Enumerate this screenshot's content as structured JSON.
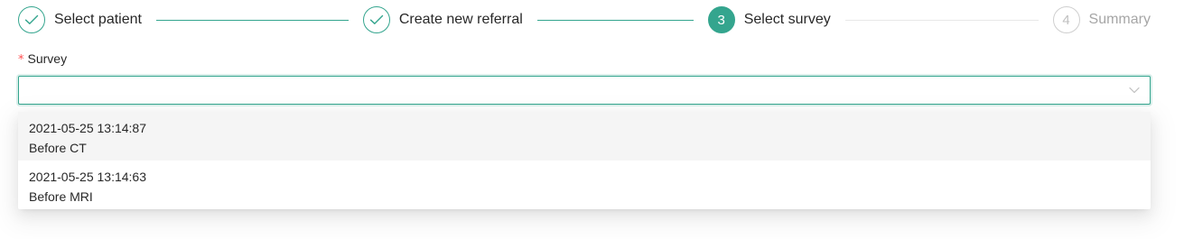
{
  "steps": [
    {
      "number": "1",
      "title": "Select patient",
      "status": "finish",
      "icon": "check-icon"
    },
    {
      "number": "2",
      "title": "Create new referral",
      "status": "finish",
      "icon": "check-icon"
    },
    {
      "number": "3",
      "title": "Select survey",
      "status": "process"
    },
    {
      "number": "4",
      "title": "Summary",
      "status": "wait"
    }
  ],
  "form": {
    "required_mark": "*",
    "survey_label": "Survey",
    "survey_value": "",
    "arrow_icon": "chevron-down-icon"
  },
  "dropdown": {
    "options": [
      {
        "date": "2021-05-25 13:14:87",
        "name": "Before CT",
        "highlighted": true
      },
      {
        "date": "2021-05-25 13:14:63",
        "name": "Before MRI",
        "highlighted": false
      }
    ]
  },
  "colors": {
    "accent": "#34a58e",
    "required": "#ff4d4f",
    "wait": "#bfbfbf",
    "option_hover": "#f5f5f5"
  }
}
